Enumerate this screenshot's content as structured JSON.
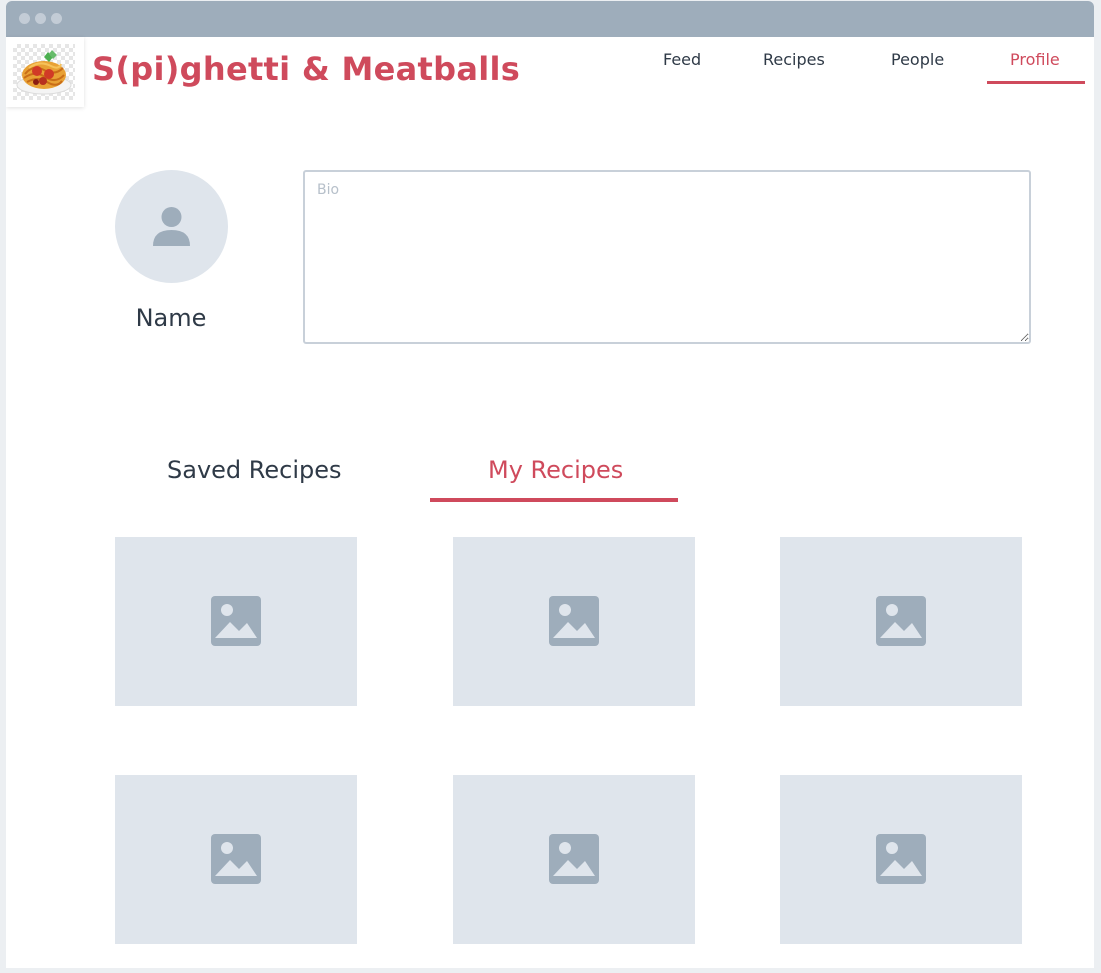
{
  "app": {
    "title": "S(pi)ghetti & Meatballs"
  },
  "nav": {
    "items": [
      {
        "label": "Feed",
        "active": false
      },
      {
        "label": "Recipes",
        "active": false
      },
      {
        "label": "People",
        "active": false
      },
      {
        "label": "Profile",
        "active": true
      }
    ]
  },
  "profile": {
    "name": "Name",
    "bio_placeholder": "Bio",
    "bio_value": ""
  },
  "tabs": [
    {
      "label": "Saved Recipes",
      "active": false
    },
    {
      "label": "My Recipes",
      "active": true
    }
  ],
  "recipes": {
    "cards": [
      {
        "icon": "image-placeholder-icon"
      },
      {
        "icon": "image-placeholder-icon"
      },
      {
        "icon": "image-placeholder-icon"
      },
      {
        "icon": "image-placeholder-icon"
      },
      {
        "icon": "image-placeholder-icon"
      },
      {
        "icon": "image-placeholder-icon"
      }
    ]
  },
  "colors": {
    "accent": "#cf4a5c",
    "text": "#2f3a47",
    "placeholder_bg": "#dfe5ec",
    "icon": "#9eadbb",
    "titlebar": "#9eadbb"
  }
}
